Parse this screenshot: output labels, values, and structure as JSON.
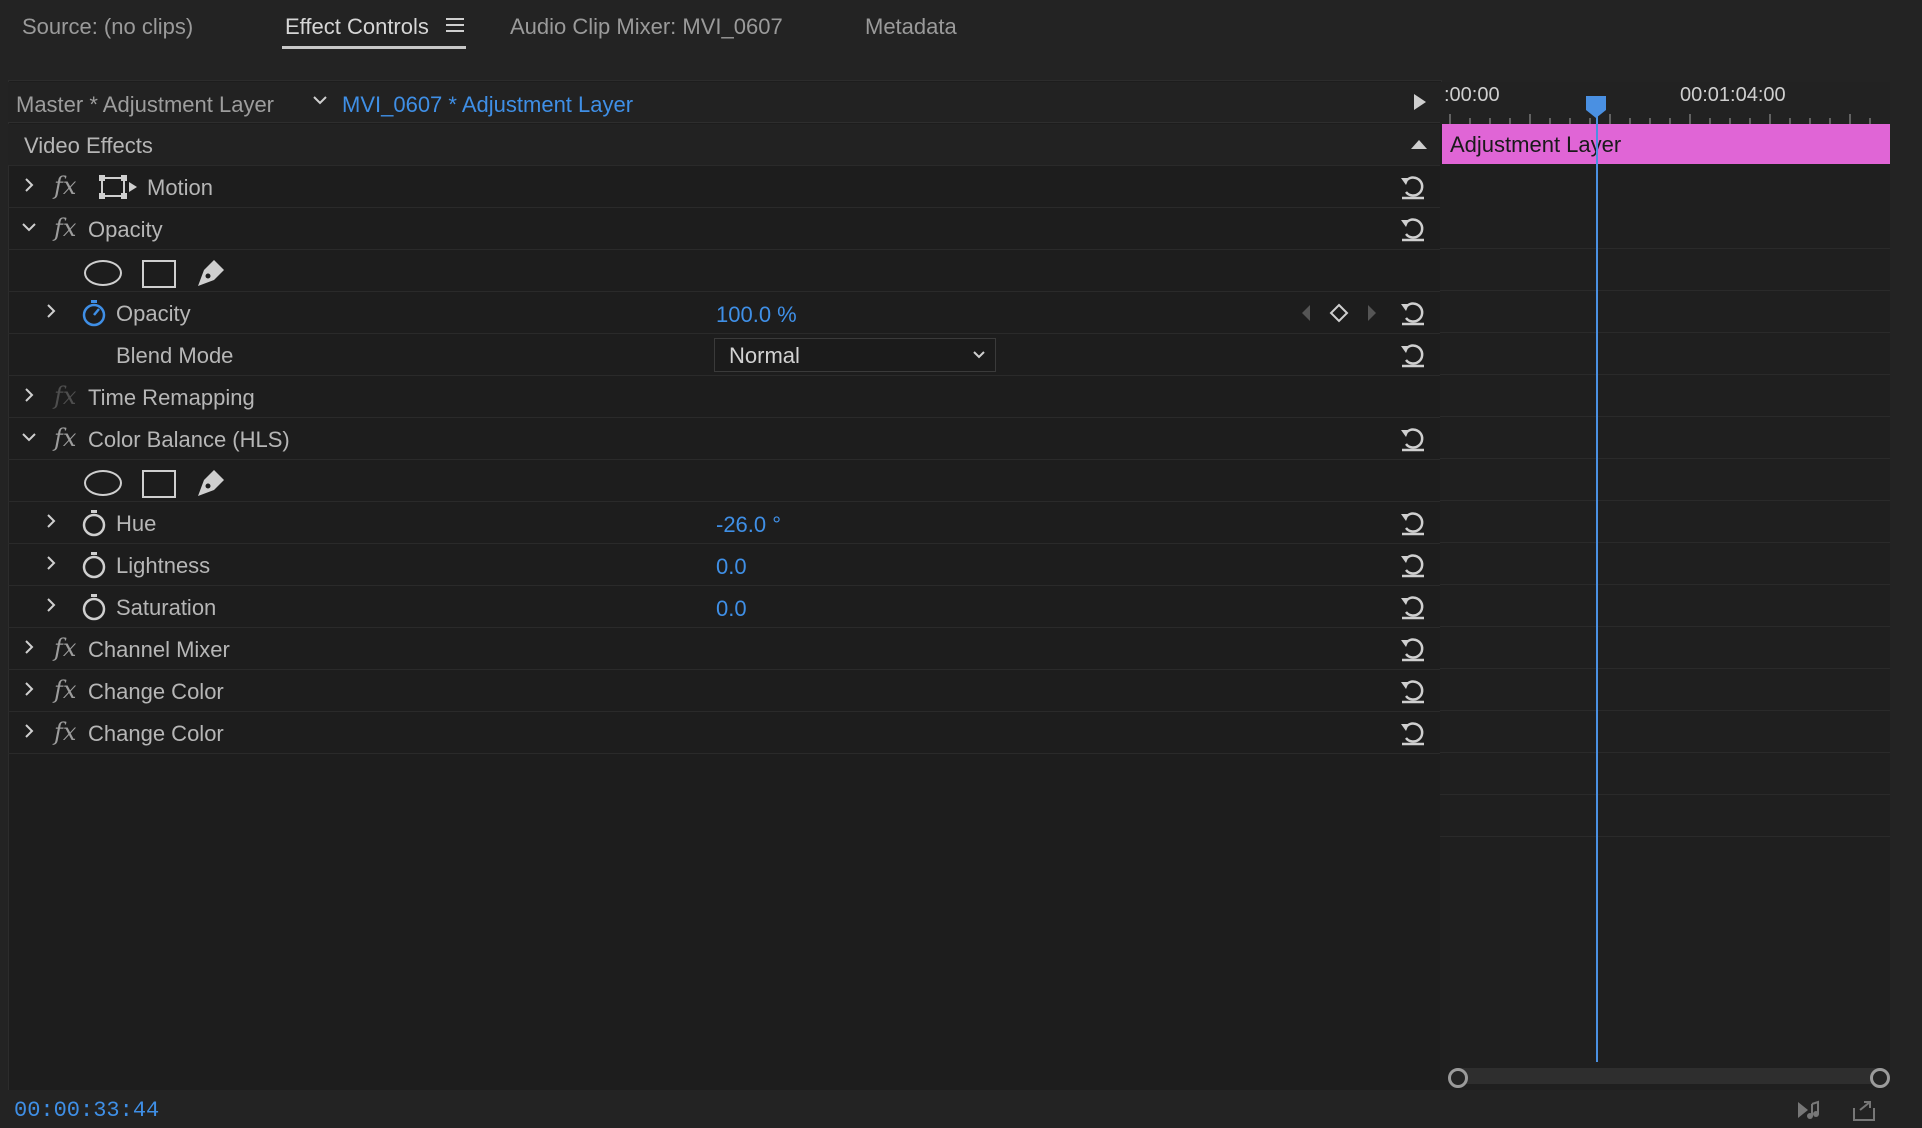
{
  "tabs": [
    {
      "label": "Source: (no clips)",
      "active": false
    },
    {
      "label": "Effect Controls",
      "active": true
    },
    {
      "label": "Audio Clip Mixer: MVI_0607",
      "active": false
    },
    {
      "label": "Metadata",
      "active": false
    }
  ],
  "clip_header": {
    "master_label": "Master * Adjustment Layer",
    "clip_label": "MVI_0607 * Adjustment Layer"
  },
  "video_effects": {
    "heading": "Video Effects",
    "rows": {
      "motion": "Motion",
      "opacity_group": "Opacity",
      "opacity_param": "Opacity",
      "opacity_value": "100.0 %",
      "blend_mode_label": "Blend Mode",
      "blend_mode_value": "Normal",
      "time_remapping": "Time Remapping",
      "color_balance": "Color Balance (HLS)",
      "hue_label": "Hue",
      "hue_value": "-26.0 °",
      "lightness_label": "Lightness",
      "lightness_value": "0.0",
      "saturation_label": "Saturation",
      "saturation_value": "0.0",
      "channel_mixer": "Channel Mixer",
      "change_color_1": "Change Color",
      "change_color_2": "Change Color"
    }
  },
  "timeline": {
    "start_tc": ":00:00",
    "end_tc": "00:01:04:00",
    "clip_label": "Adjustment Layer"
  },
  "status": {
    "current_time": "00:00:33:44"
  },
  "colors": {
    "accent_blue": "#3f8fe6",
    "clip_pink": "#e065d6",
    "background": "#1d1d1d"
  },
  "icons": [
    "fx-icon",
    "reset-icon",
    "stopwatch-icon",
    "ellipse-mask-icon",
    "rectangle-mask-icon",
    "pen-mask-icon",
    "chevron-right-icon",
    "chevron-down-icon",
    "keyframe-icon"
  ]
}
